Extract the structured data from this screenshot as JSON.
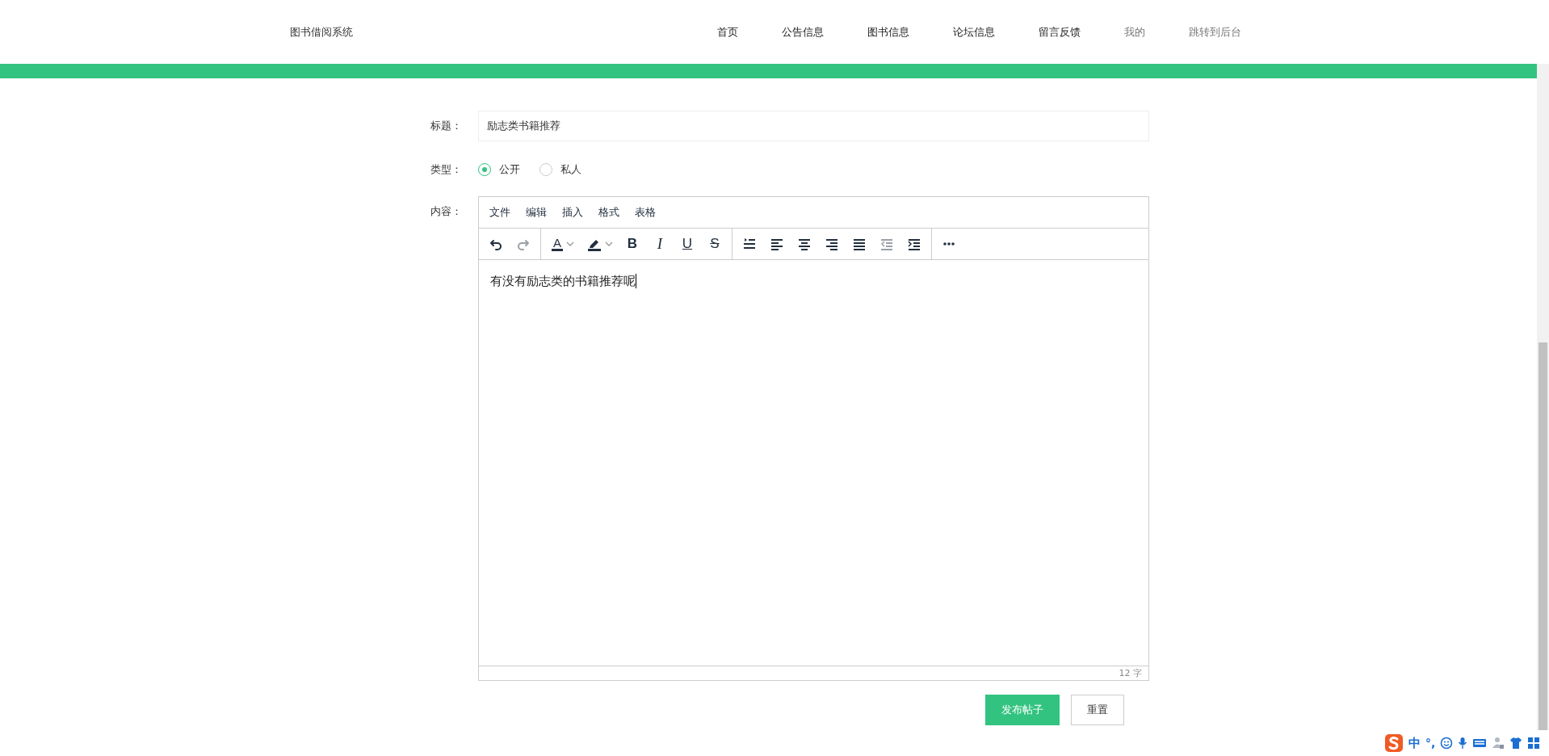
{
  "header": {
    "site_title": "图书借阅系统",
    "nav": [
      {
        "label": "首页",
        "dim": false
      },
      {
        "label": "公告信息",
        "dim": false
      },
      {
        "label": "图书信息",
        "dim": false
      },
      {
        "label": "论坛信息",
        "dim": false
      },
      {
        "label": "留言反馈",
        "dim": false
      },
      {
        "label": "我的",
        "dim": true
      },
      {
        "label": "跳转到后台",
        "dim": true
      }
    ]
  },
  "form": {
    "title_field": {
      "label": "标题：",
      "value": "励志类书籍推荐"
    },
    "type_field": {
      "label": "类型：",
      "options": [
        {
          "label": "公开",
          "selected": true
        },
        {
          "label": "私人",
          "selected": false
        }
      ]
    },
    "content_field": {
      "label": "内容：",
      "menus": [
        "文件",
        "编辑",
        "插入",
        "格式",
        "表格"
      ],
      "toolbar": [
        [
          {
            "kind": "undo",
            "disabled": false
          },
          {
            "kind": "redo",
            "disabled": true
          }
        ],
        [
          {
            "kind": "forecolor",
            "glyph": "A",
            "disabled": false
          },
          {
            "kind": "highlight",
            "disabled": false
          },
          {
            "kind": "bold",
            "glyph": "B",
            "disabled": false
          },
          {
            "kind": "italic",
            "glyph": "I",
            "disabled": false
          },
          {
            "kind": "underline",
            "glyph": "U",
            "disabled": false
          },
          {
            "kind": "strike",
            "glyph": "S",
            "disabled": false
          }
        ],
        [
          {
            "kind": "lineheight",
            "disabled": false
          },
          {
            "kind": "alignleft",
            "disabled": false
          },
          {
            "kind": "aligncenter",
            "disabled": false
          },
          {
            "kind": "alignright",
            "disabled": false
          },
          {
            "kind": "justify",
            "disabled": false
          },
          {
            "kind": "outdent",
            "disabled": true
          },
          {
            "kind": "indent",
            "disabled": false
          }
        ],
        [
          {
            "kind": "more",
            "disabled": false
          }
        ]
      ],
      "text": "有没有励志类的书籍推荐呢",
      "word_count": "12 字"
    },
    "buttons": [
      {
        "label": "发布帖子",
        "kind": "primary"
      },
      {
        "label": "重置",
        "kind": "default"
      }
    ]
  },
  "ime": {
    "mode": "中",
    "punct": "°,"
  }
}
